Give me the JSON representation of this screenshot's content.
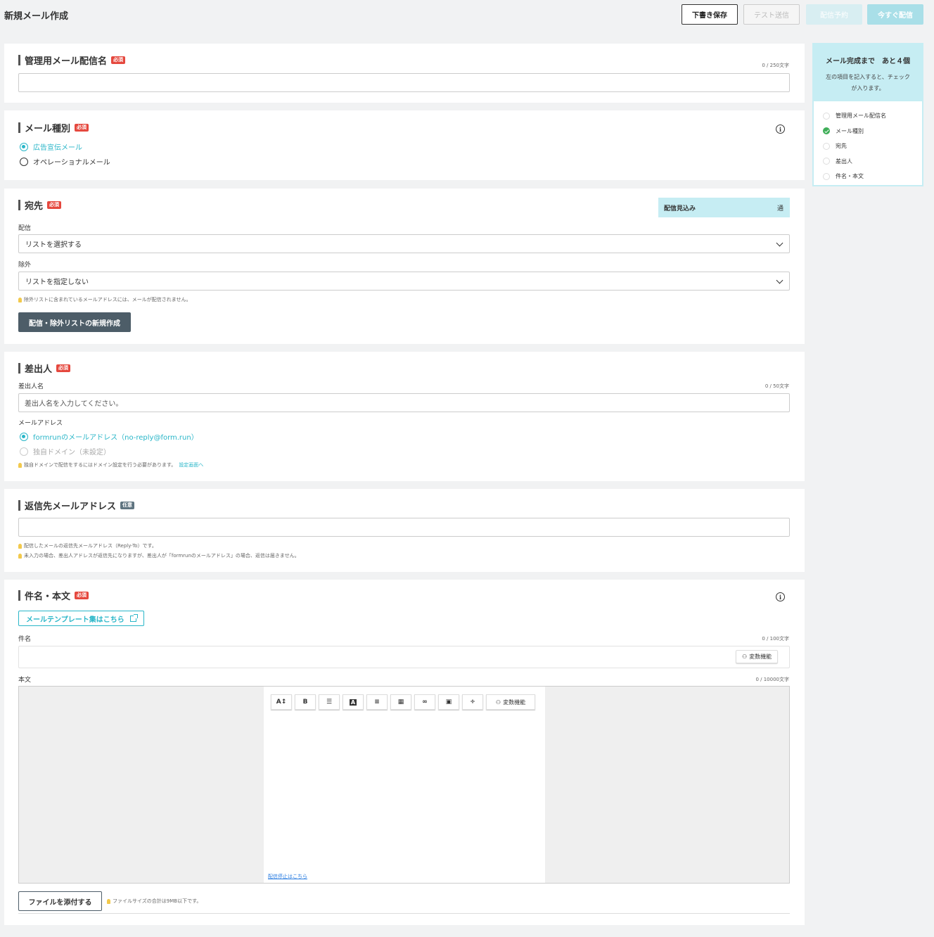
{
  "page": {
    "title": "新規メール作成"
  },
  "topbar": {
    "draft_save": "下書き保存",
    "test_send": "テスト送信",
    "schedule": "配信予約",
    "send_now": "今すぐ配信"
  },
  "badges": {
    "required": "必須",
    "optional": "任意"
  },
  "admin_name": {
    "title": "管理用メール配信名",
    "counter": "0 / 250文字",
    "value": ""
  },
  "mail_type": {
    "title": "メール種別",
    "options": [
      "広告宣伝メール",
      "オペレーショナルメール"
    ],
    "selected": "広告宣伝メール"
  },
  "recipient": {
    "title": "宛先",
    "estimate_label": "配信見込み",
    "estimate_unit": "通",
    "deliver_label": "配信",
    "deliver_value": "リストを選択する",
    "exclude_label": "除外",
    "exclude_value": "リストを指定しない",
    "hint": "除外リストに含まれているメールアドレスには、メールが配信されません。",
    "create_list_button": "配信・除外リストの新規作成"
  },
  "sender": {
    "title": "差出人",
    "name_label": "差出人名",
    "name_counter": "0 / 50文字",
    "name_placeholder": "差出人名を入力してください。",
    "email_label": "メールアドレス",
    "email_options": [
      "formrunのメールアドレス（no-reply@form.run）",
      "独自ドメイン（未設定）"
    ],
    "hint": "独自ドメインで配信をするにはドメイン設定を行う必要があります。",
    "hint_link": "設定画面へ"
  },
  "reply_to": {
    "title": "返信先メールアドレス",
    "value": "",
    "hint1": "配信したメールの返信先メールアドレス（Reply-To）です。",
    "hint2": "未入力の場合、差出人アドレスが返信先になりますが、差出人が「formrunのメールアドレス」の場合、返信は届きません。"
  },
  "subject_body": {
    "title": "件名・本文",
    "template_button": "メールテンプレート集はこちら",
    "subject_label": "件名",
    "subject_counter": "0 / 100文字",
    "variable_button": "変数機能",
    "body_label": "本文",
    "body_counter": "0 / 10000文字",
    "toolbar": [
      "A↕",
      "B",
      "list",
      "A",
      "align",
      "table",
      "link",
      "image",
      "strike"
    ],
    "toolbar_variable": "変数機能",
    "unsubscribe_link": "配信停止はこちら",
    "attach_button": "ファイルを添付する",
    "attach_hint": "ファイルサイズの合計は9MB以下です。"
  },
  "progress": {
    "title": "メール完成まで　あと４個",
    "desc": "左の項目を記入すると、チェックが入ります。",
    "items": [
      {
        "label": "管理用メール配信名",
        "done": false
      },
      {
        "label": "メール種別",
        "done": true
      },
      {
        "label": "宛先",
        "done": false
      },
      {
        "label": "差出人",
        "done": false
      },
      {
        "label": "件名・本文",
        "done": false
      }
    ]
  },
  "colors": {
    "accent": "#29b6c8",
    "required": "#e5483e",
    "dark_button": "#4d5d68",
    "check": "#3fae58"
  }
}
